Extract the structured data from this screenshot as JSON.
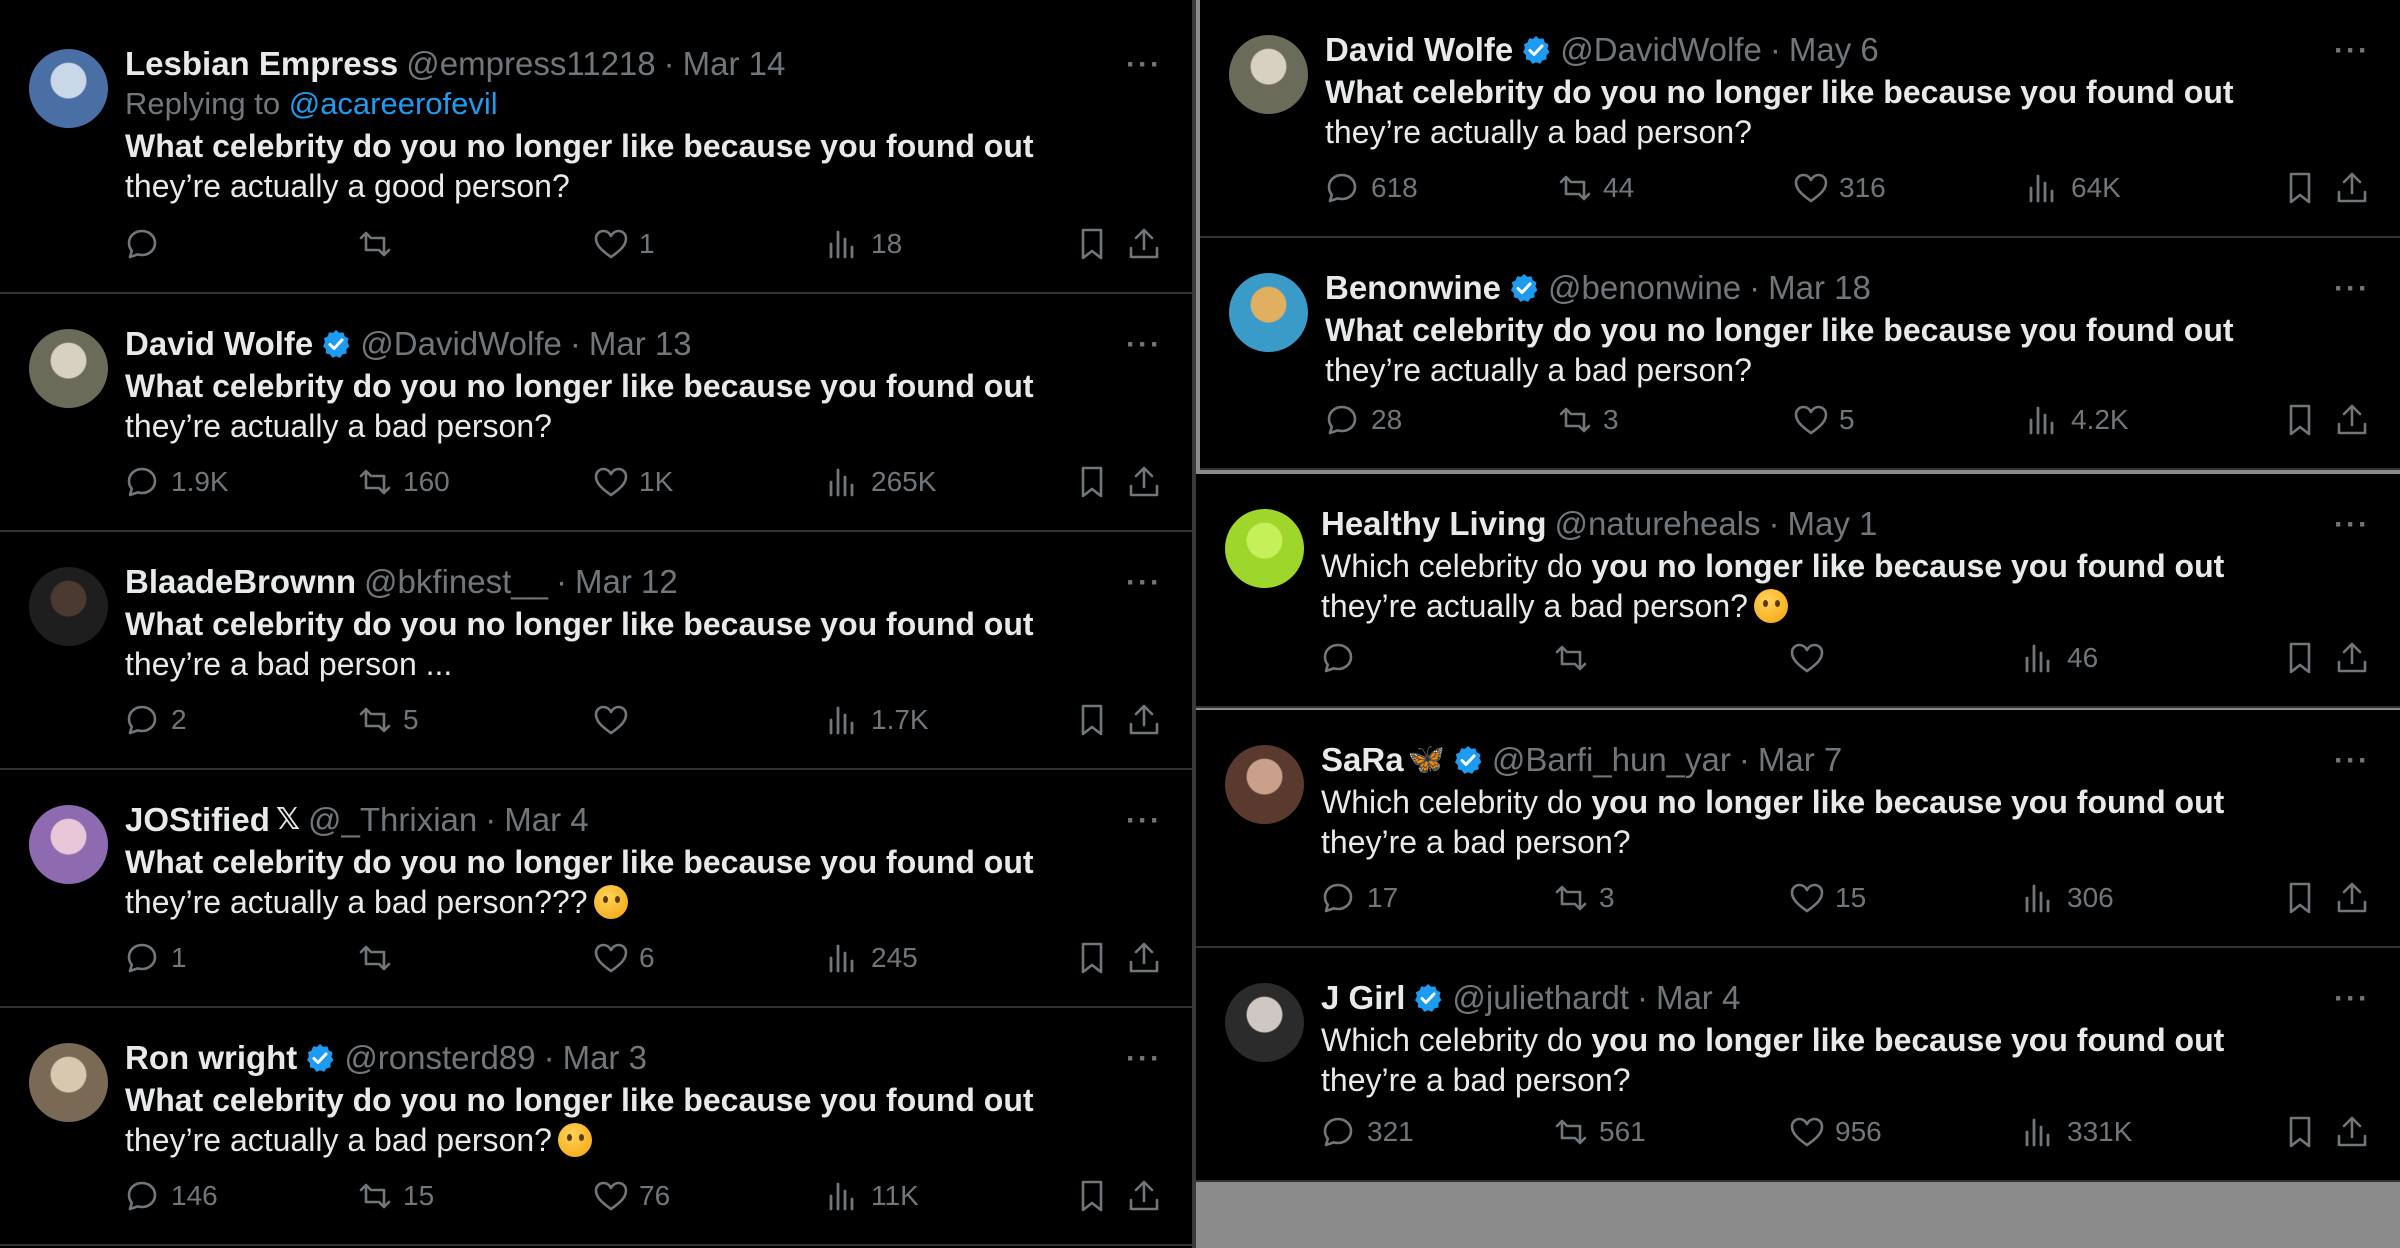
{
  "colors": {
    "background": "#000000",
    "text": "#e7e9ea",
    "muted": "#71767b",
    "link": "#1d9bf0",
    "verified": "#1d9bf0",
    "border": "#2f3336"
  },
  "icons": {
    "reply": "speech-bubble",
    "retweet": "retweet-arrows",
    "like": "heart",
    "views": "bar-chart",
    "bookmark": "bookmark",
    "share": "upload-arrow",
    "more": "ellipsis",
    "verified": "verified-badge"
  },
  "left": [
    {
      "name": "Lesbian Empress",
      "handle": "@empress11218",
      "date": "Mar 14",
      "verified": false,
      "replying_prefix": "Replying to ",
      "replying_handle": "@acareerofevil",
      "text_bold": "What celebrity do you no longer like because you found out",
      "text_rest": " they’re actually a good person?",
      "emoji": false,
      "replies": "",
      "retweets": "",
      "likes": "1",
      "views": "18",
      "avatar": [
        "#4a6fa5",
        "#c9d7e8"
      ]
    },
    {
      "name": "David Wolfe",
      "handle": "@DavidWolfe",
      "date": "Mar 13",
      "verified": true,
      "text_bold": "What celebrity do you no longer like because you found out",
      "text_rest": " they’re actually a bad person?",
      "emoji": false,
      "replies": "1.9K",
      "retweets": "160",
      "likes": "1K",
      "views": "265K",
      "avatar": [
        "#6b6b5a",
        "#d8d0c0"
      ]
    },
    {
      "name": "BlaadeBrownn",
      "handle": "@bkfinest__",
      "date": "Mar 12",
      "verified": false,
      "text_bold": "What celebrity do you no longer like because you found out",
      "text_rest": " they’re a bad person ...",
      "emoji": false,
      "replies": "2",
      "retweets": "5",
      "likes": "",
      "views": "1.7K",
      "avatar": [
        "#1e1e1e",
        "#4b3a30"
      ]
    },
    {
      "name": "JOStified",
      "handle": "@_Thrixian",
      "date": "Mar 4",
      "verified": false,
      "x_logo": "𝕏",
      "text_bold": "What celebrity do you no longer like because you found out",
      "text_rest": " they’re actually a bad person???",
      "emoji": true,
      "replies": "1",
      "retweets": "",
      "likes": "6",
      "views": "245",
      "avatar": [
        "#8e6bb0",
        "#e9c7d8"
      ]
    },
    {
      "name": "Ron wright",
      "handle": "@ronsterd89",
      "date": "Mar 3",
      "verified": true,
      "text_bold": "What celebrity do you no longer like because you found out",
      "text_rest": " they’re actually a bad person?",
      "emoji": true,
      "replies": "146",
      "retweets": "15",
      "likes": "76",
      "views": "11K",
      "avatar": [
        "#7a6a55",
        "#d9c8b0"
      ]
    }
  ],
  "right": [
    {
      "name": "David Wolfe",
      "handle": "@DavidWolfe",
      "date": "May 6",
      "verified": true,
      "text_bold": "What celebrity do you no longer like because you found out",
      "text_rest": " they’re actually a bad person?",
      "emoji": false,
      "replies": "618",
      "retweets": "44",
      "likes": "316",
      "views": "64K",
      "avatar": [
        "#6b6b5a",
        "#d8d0c0"
      ]
    },
    {
      "name": "Benonwine",
      "handle": "@benonwine",
      "date": "Mar 18",
      "verified": true,
      "text_bold": "What celebrity do you no longer like because you found out",
      "text_rest": " they’re actually a bad person?",
      "emoji": false,
      "replies": "28",
      "retweets": "3",
      "likes": "5",
      "views": "4.2K",
      "avatar": [
        "#3a9ac8",
        "#e0b060"
      ]
    },
    {
      "name": "Healthy Living",
      "handle": "@natureheals",
      "date": "May 1",
      "verified": false,
      "text_pre": "Which celebrity do ",
      "text_bold": "you no longer like because you found out",
      "text_rest": " they’re actually a bad person?",
      "emoji": true,
      "replies": "",
      "retweets": "",
      "likes": "",
      "views": "46",
      "avatar": [
        "#9fd62b",
        "#c6f05a"
      ]
    },
    {
      "name": "SaRa",
      "handle": "@Barfi_hun_yar",
      "date": "Mar 7",
      "verified": true,
      "butterfly": "🦋",
      "text_pre": "Which celebrity do ",
      "text_bold": "you no longer like because you found out",
      "text_rest": " they’re a bad person?",
      "emoji": false,
      "replies": "17",
      "retweets": "3",
      "likes": "15",
      "views": "306",
      "avatar": [
        "#5a3a2e",
        "#c9a08a"
      ]
    },
    {
      "name": "J Girl",
      "handle": "@juliethardt",
      "date": "Mar 4",
      "verified": true,
      "text_pre": "Which celebrity do ",
      "text_bold": "you no longer like because you found out",
      "text_rest": " they’re a bad person?",
      "emoji": false,
      "replies": "321",
      "retweets": "561",
      "likes": "956",
      "views": "331K",
      "avatar": [
        "#2b2b2b",
        "#cfc7c2"
      ]
    }
  ],
  "more_label": "···"
}
